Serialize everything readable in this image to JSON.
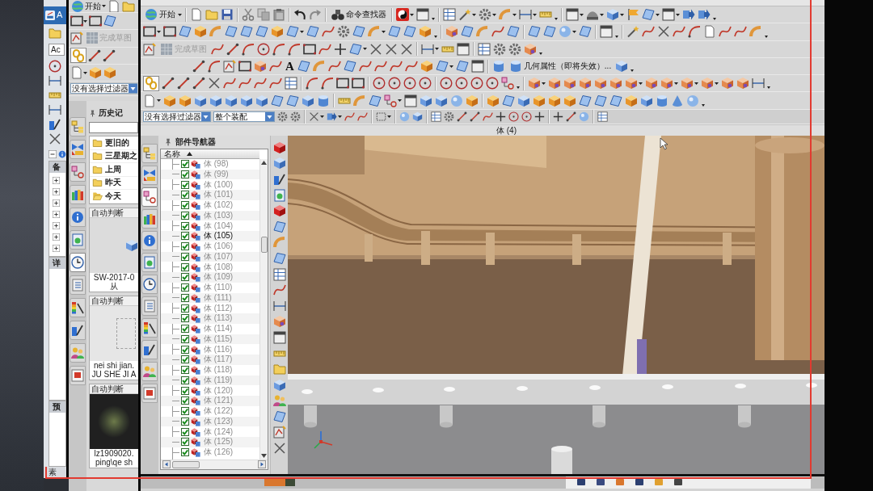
{
  "far_left_window": {
    "title": "A",
    "field_value": "Ac",
    "sections": [
      "备",
      "详",
      "预"
    ],
    "footer": "素"
  },
  "history_window": {
    "toolbar": {
      "start_button": "开始",
      "finish_sketch": {
        "label": "完成草图",
        "disabled": true
      },
      "chain_toggle": {
        "on": true
      },
      "selection_filter": "没有选择过滤器"
    },
    "side_tabs": [
      {
        "selected": false
      },
      {
        "selected": false
      },
      {
        "selected": false
      },
      {
        "selected": false
      },
      {
        "selected": false
      },
      {
        "selected": false
      },
      {
        "selected": true
      },
      {
        "selected": false
      },
      {
        "selected": false
      },
      {
        "selected": false
      },
      {
        "selected": false
      },
      {
        "selected": false
      }
    ],
    "history_panel": {
      "title": "历史记",
      "folders": [
        {
          "label": "更旧的",
          "open": false
        },
        {
          "label": "三星期之",
          "open": false
        },
        {
          "label": "上周",
          "open": false
        },
        {
          "label": "昨天",
          "open": false
        },
        {
          "label": "今天",
          "open": true
        }
      ],
      "entries": [
        {
          "tag": "自动判断",
          "kind": "icon",
          "lines": [
            "SW-2017-0",
            "从"
          ]
        },
        {
          "tag": "自动判断",
          "kind": "empty",
          "lines": [
            "nei shi jian.",
            "JU SHE JI A"
          ]
        },
        {
          "tag": "自动判断",
          "kind": "photo",
          "lines": [
            "lz1909020.",
            "ping\\qe sh"
          ]
        }
      ]
    }
  },
  "main_window": {
    "toolbar": {
      "start_button": "开始",
      "command_finder": "命令查找器",
      "finish_sketch": {
        "label": "完成草图",
        "disabled": true
      },
      "text_tool": "A",
      "geometry_properties": "几何属性（即将失效）...",
      "chain_toggle": {
        "on": true
      },
      "selection_filter": "没有选择过滤器",
      "assembly_scope": "整个装配"
    },
    "view_title": "体 (4)",
    "side_tabs": [
      {
        "selected": false
      },
      {
        "selected": false
      },
      {
        "selected": true
      },
      {
        "selected": false
      },
      {
        "selected": false
      },
      {
        "selected": false
      },
      {
        "selected": false
      },
      {
        "selected": false
      },
      {
        "selected": false
      },
      {
        "selected": false
      },
      {
        "selected": false
      },
      {
        "selected": false
      }
    ],
    "part_navigator": {
      "title": "部件导航器",
      "column": "名称",
      "rows": [
        {
          "label": "体 (98)",
          "checked": true,
          "selected": false
        },
        {
          "label": "体 (99)",
          "checked": true,
          "selected": false
        },
        {
          "label": "体 (100)",
          "checked": true,
          "selected": false
        },
        {
          "label": "体 (101)",
          "checked": true,
          "selected": false
        },
        {
          "label": "体 (102)",
          "checked": true,
          "selected": false
        },
        {
          "label": "体 (103)",
          "checked": true,
          "selected": false
        },
        {
          "label": "体 (104)",
          "checked": true,
          "selected": false
        },
        {
          "label": "体 (105)",
          "checked": true,
          "selected": true
        },
        {
          "label": "体 (106)",
          "checked": true,
          "selected": false
        },
        {
          "label": "体 (107)",
          "checked": true,
          "selected": false
        },
        {
          "label": "体 (108)",
          "checked": true,
          "selected": false
        },
        {
          "label": "体 (109)",
          "checked": true,
          "selected": false
        },
        {
          "label": "体 (110)",
          "checked": true,
          "selected": false
        },
        {
          "label": "体 (111)",
          "checked": true,
          "selected": false
        },
        {
          "label": "体 (112)",
          "checked": true,
          "selected": false
        },
        {
          "label": "体 (113)",
          "checked": true,
          "selected": false
        },
        {
          "label": "体 (114)",
          "checked": true,
          "selected": false
        },
        {
          "label": "体 (115)",
          "checked": true,
          "selected": false
        },
        {
          "label": "体 (116)",
          "checked": true,
          "selected": false
        },
        {
          "label": "体 (117)",
          "checked": true,
          "selected": false
        },
        {
          "label": "体 (118)",
          "checked": true,
          "selected": false
        },
        {
          "label": "体 (119)",
          "checked": true,
          "selected": false
        },
        {
          "label": "体 (120)",
          "checked": true,
          "selected": false
        },
        {
          "label": "体 (121)",
          "checked": true,
          "selected": false
        },
        {
          "label": "体 (122)",
          "checked": true,
          "selected": false
        },
        {
          "label": "体 (123)",
          "checked": true,
          "selected": false
        },
        {
          "label": "体 (124)",
          "checked": true,
          "selected": false
        },
        {
          "label": "体 (125)",
          "checked": true,
          "selected": false
        },
        {
          "label": "体 (126)",
          "checked": true,
          "selected": false
        }
      ]
    }
  }
}
